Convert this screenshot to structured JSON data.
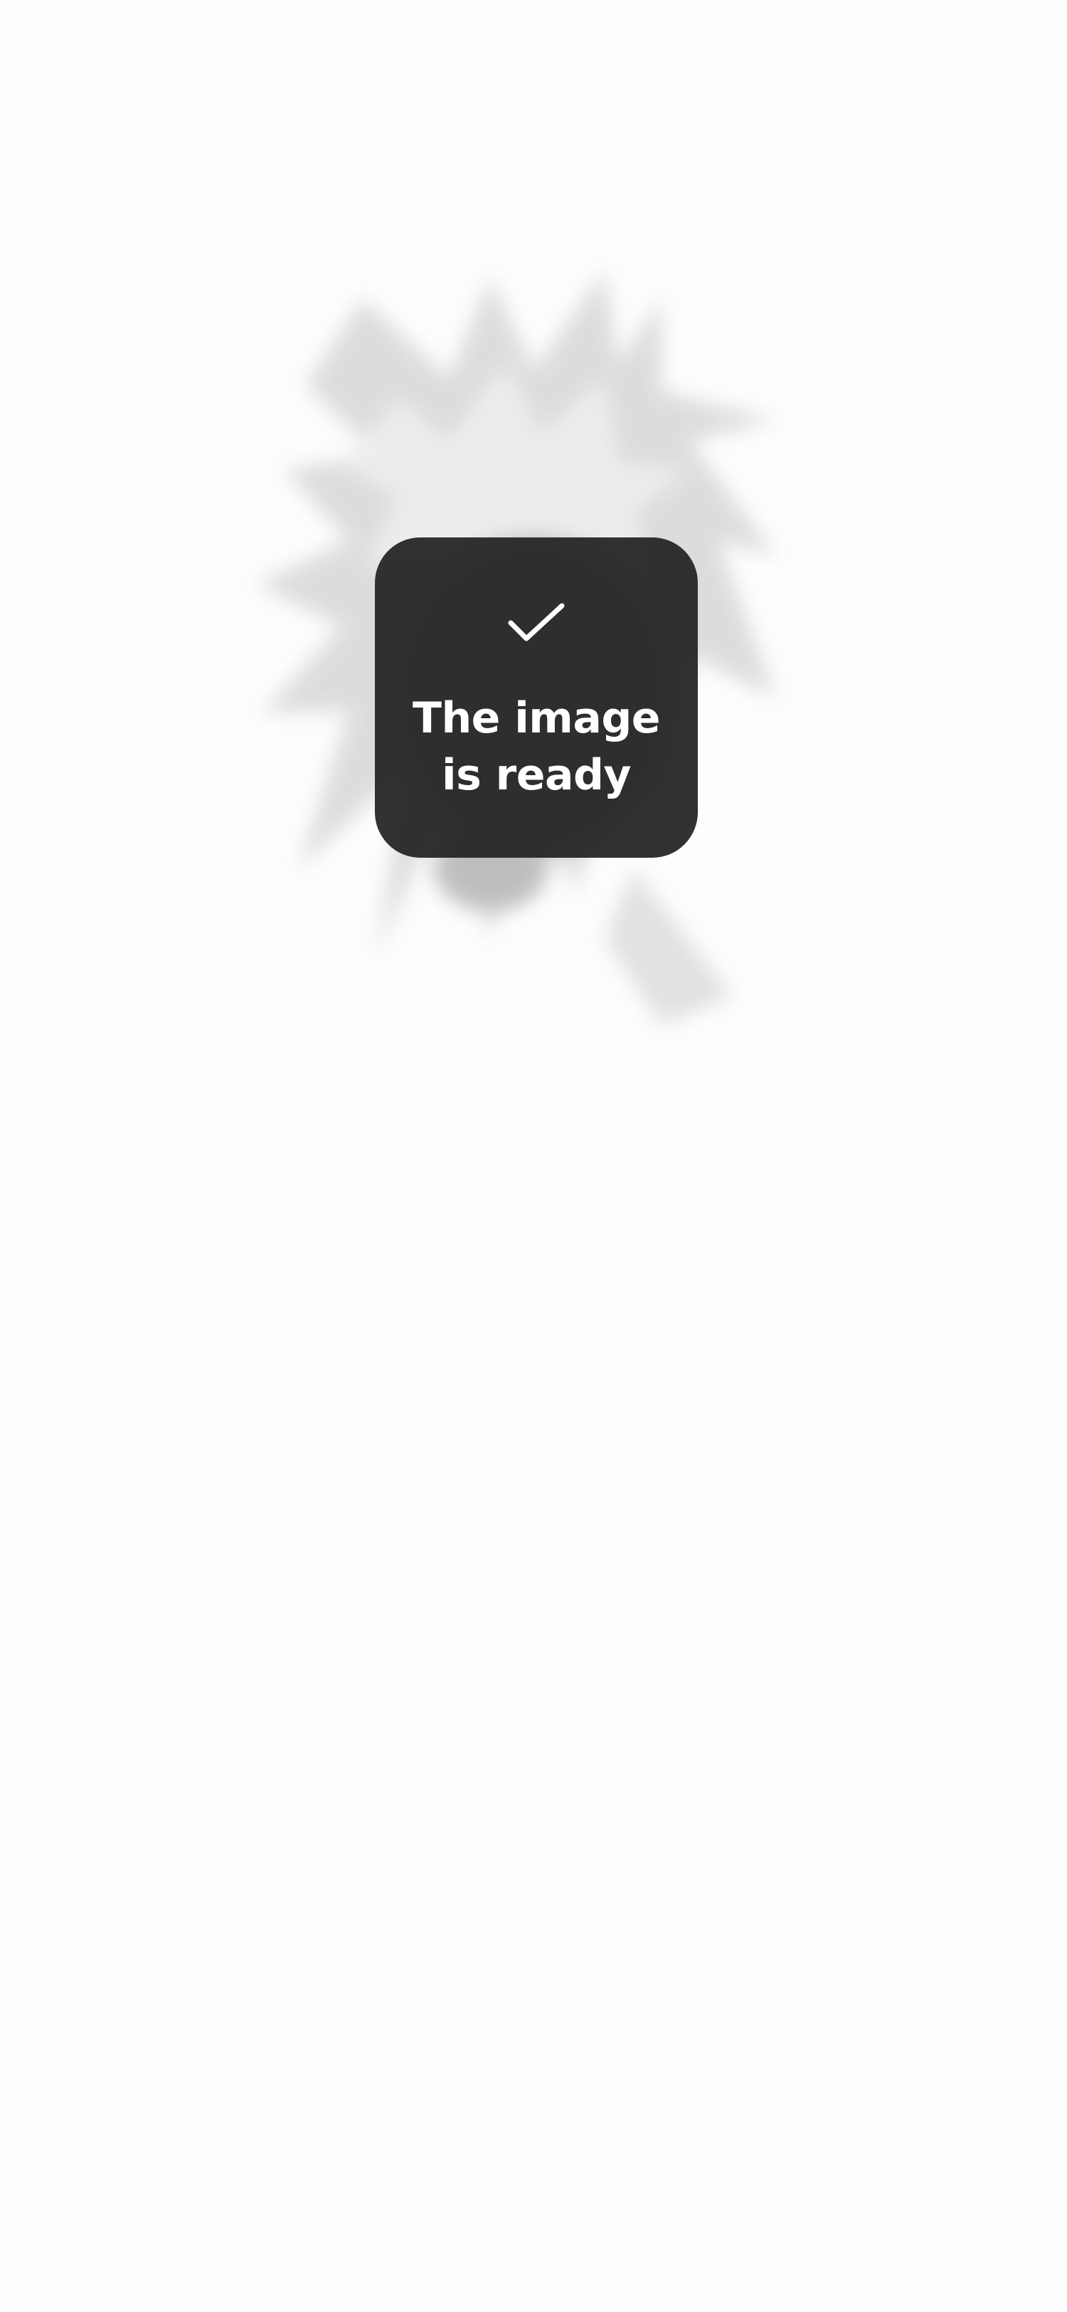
{
  "toast": {
    "icon": "checkmark-icon",
    "message": "The image is ready",
    "background_color": "#222222",
    "text_color": "#ffffff"
  },
  "background": {
    "color": "#fdfdfd",
    "content": "blurred-artwork"
  }
}
